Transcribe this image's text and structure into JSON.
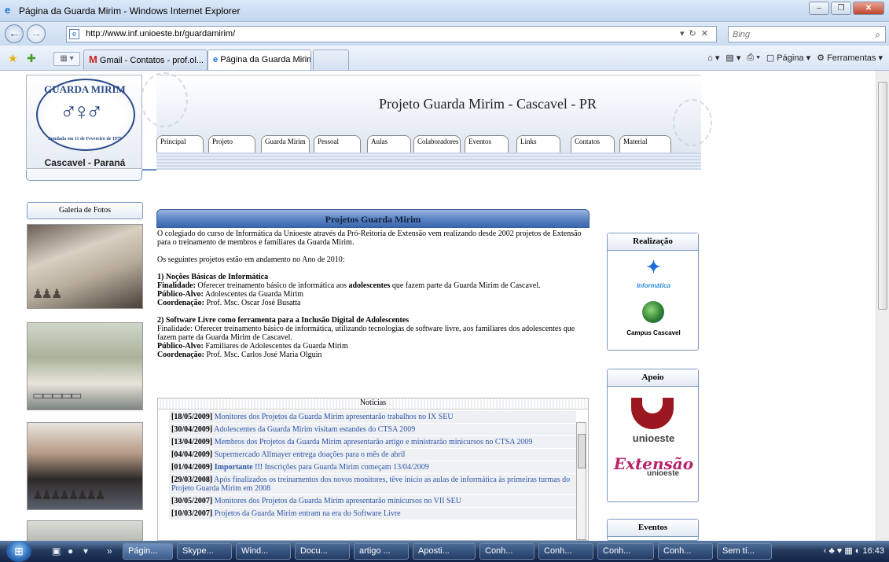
{
  "window": {
    "title": "Página da Guarda Mirim - Windows Internet Explorer"
  },
  "address": {
    "url": "http://www.inf.unioeste.br/guardamirim/",
    "search_placeholder": "Bing"
  },
  "tabs": [
    {
      "label": "Gmail - Contatos - prof.ol..."
    },
    {
      "label": "Página da Guarda Mirim"
    }
  ],
  "commands": {
    "page": "Página",
    "tools": "Ferramentas"
  },
  "site": {
    "logo_top": "GUARDA MIRIM",
    "logo_side": "Fundada em 11 de Fevereiro de 1979",
    "logo_city": "Cascavel - Paraná",
    "banner_title": "Projeto Guarda Mirim - Cascavel - PR",
    "nav": [
      "Principal",
      "Projeto",
      "Guarda Mirim",
      "Pessoal",
      "Aulas",
      "Colaboradores",
      "Eventos",
      "Links",
      "Contatos",
      "Material"
    ],
    "gallery_title": "Galeria de Fotos"
  },
  "main": {
    "panel_title": "Projetos Guarda Mirim",
    "intro": "O colegiado do curso de Informática da Unioeste através da Pró-Reitoria de Extensão vem realizando desde 2002 projetos de Extensão para o treinamento de membros e familiares da Guarda Mirim.",
    "status": "Os seguintes projetos estão em andamento no Ano de 2010:",
    "p1": {
      "title": "1) Noções Básicas de Informática",
      "fin_label": "Finalidade:",
      "fin_pre": "Oferecer treinamento básico de informática aos",
      "fin_bold": "adolescentes",
      "fin_post": "que fazem parte da Guarda Mirim de Cascavel.",
      "pub_label": "Público-Alvo:",
      "pub": "Adolescentes da Guarda Mirim",
      "coord_label": "Coordenação:",
      "coord": "Prof. Msc. Oscar José Busatta"
    },
    "p2": {
      "title": "2) Software Livre como ferramenta para a Inclusão Digital de Adolescentes",
      "fin": "Finalidade: Oferecer treinamento básico de informática, utilizando tecnologias de software livre, aos familiares dos adolescentes que fazem parte da Guarda Mirim de Cascavel.",
      "pub_label": "Público-Alvo:",
      "pub": "Familiares de Adolescentes da Guarda Mirim",
      "coord_label": "Coordenação:",
      "coord": "Prof. Msc. Carlos José Maria Olguin"
    }
  },
  "news": {
    "title": "Notícias",
    "items": [
      {
        "date": "[18/05/2009]",
        "text": "Monitores dos Projetos da Guarda Mirim apresentarão trabalhos no IX SEU"
      },
      {
        "date": "[30/04/2009]",
        "text": "Adolescentes da Guarda Mirim visitam estandes do CTSA 2009"
      },
      {
        "date": "[13/04/2009]",
        "text": "Membros dos Projetos da Guarda Mirim apresentarão artigo e ministrarão minicursos no CTSA 2009"
      },
      {
        "date": "[04/04/2009]",
        "text": "Supermercado Allmayer entrega doações para o mês de abril"
      },
      {
        "date": "[01/04/2009]",
        "important": "Importante !!!",
        "text": "Inscrições para Guarda Mirim começam 13/04/2009"
      },
      {
        "date": "[29/03/2008]",
        "text": "Após finalizados os treinamentos dos novos monitores, têve início as aulas de informática às primeiras turmas do Projeto Guarda Mirim em 2008"
      },
      {
        "date": "[30/05/2007]",
        "text": "Monitores dos Projetos da Guarda Mirim apresentarão minicursos no VII SEU"
      },
      {
        "date": "[10/03/2007]",
        "text": "Projetos da Guarda Mirim entram na era do Software Livre"
      }
    ]
  },
  "sidebar": {
    "realizacao": "Realização",
    "informatica": "Informática",
    "campus": "Campus Cascavel",
    "apoio": "Apoio",
    "unioeste": "unioeste",
    "extensao": "Extensão",
    "extensao_sub": "unioeste",
    "eventos": "Eventos"
  },
  "taskbar": {
    "items": [
      "Págin...",
      "Skype...",
      "Wind...",
      "Docu...",
      "artigo ...",
      "Aposti...",
      "Conh...",
      "Conh...",
      "Conh...",
      "Conh...",
      "Sem tí..."
    ],
    "clock": "16:43"
  }
}
